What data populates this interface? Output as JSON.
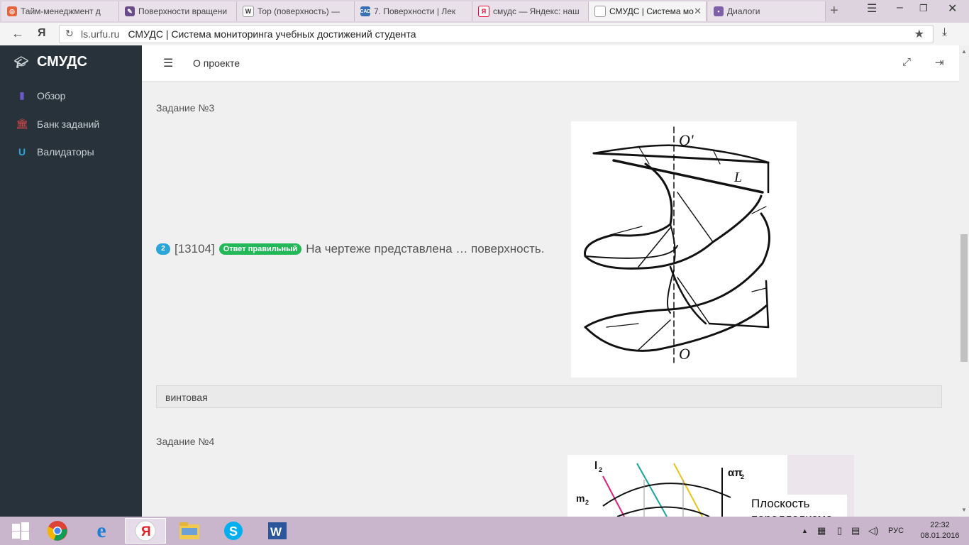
{
  "browser": {
    "tabs": [
      {
        "label": "Тайм-менеджмент д",
        "icon": "d-icon"
      },
      {
        "label": "Поверхности вращени",
        "icon": "pen-icon"
      },
      {
        "label": "Тор (поверхность) —",
        "icon": "W"
      },
      {
        "label": "7. Поверхности | Лек",
        "icon": "CAD"
      },
      {
        "label": "смудс — Яндекс: наш",
        "icon": "Я"
      },
      {
        "label": "СМУДС | Система мо",
        "icon": "page-icon"
      },
      {
        "label": "Диалоги",
        "icon": "chat-icon"
      }
    ],
    "url_host": "ls.urfu.ru",
    "url_title": "СМУДС | Система мониторинга учебных достижений студента",
    "yandex_letter": "Я"
  },
  "sidebar": {
    "brand": "СМУДС",
    "items": [
      {
        "label": "Обзор",
        "icon": "bar-chart-icon",
        "color": "#6b59c9"
      },
      {
        "label": "Банк заданий",
        "icon": "bank-icon",
        "color": "#e04848"
      },
      {
        "label": "Валидаторы",
        "icon": "magnet-icon",
        "color": "#2aa5d8"
      }
    ]
  },
  "header": {
    "about": "О проекте"
  },
  "task3": {
    "title": "Задание №3",
    "number": "2",
    "id": "[13104]",
    "badge": "Ответ правильный",
    "question": "На чертеже представлена … поверхность.",
    "figure_labels": {
      "top": "O'",
      "line": "L",
      "bottom": "O"
    },
    "answer": "винтовая"
  },
  "task4": {
    "title": "Задание №4",
    "figure_labels": {
      "l": "l",
      "l_sub": "2",
      "m": "m",
      "m_sub": "2",
      "alpha": "απ",
      "alpha_sub": "2",
      "note": "Плоскость",
      "note2": "параллелизма"
    }
  },
  "taskbar": {
    "lang": "РУС",
    "time": "22:32",
    "date": "08.01.2016"
  },
  "colors": {
    "sidebar_bg": "#27323a",
    "badge_green": "#22b858",
    "qnum_blue": "#2aa5d8"
  }
}
